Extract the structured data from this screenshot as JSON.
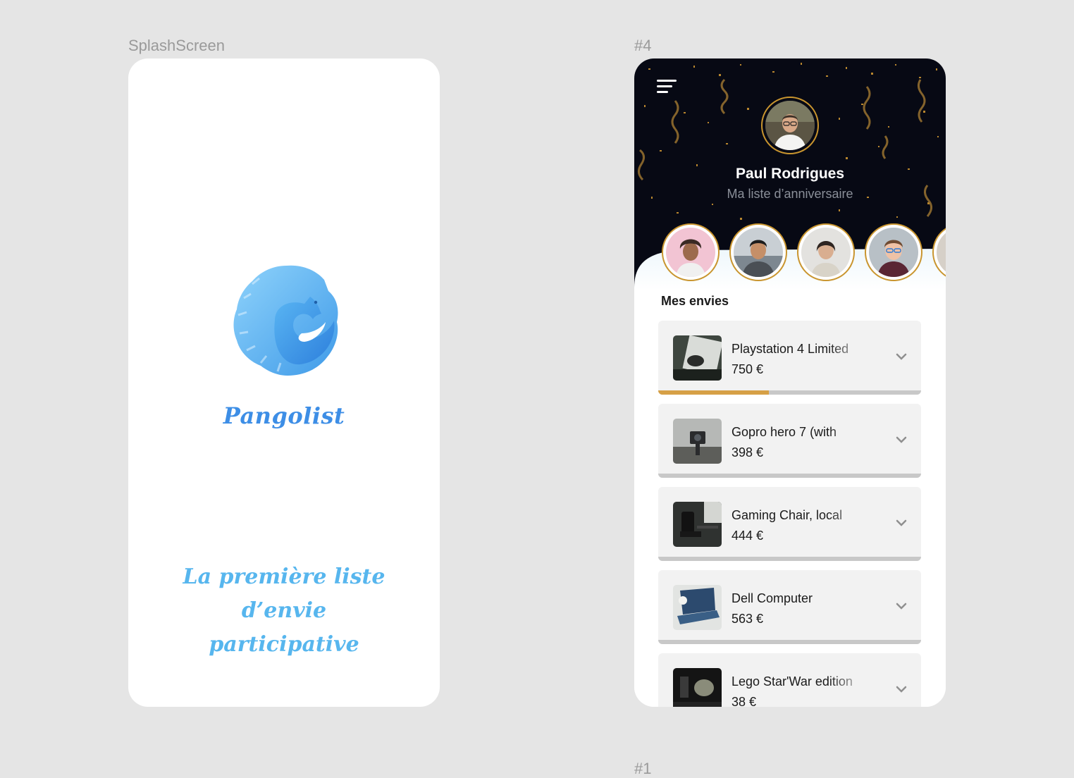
{
  "canvas": {
    "splash_label": "SplashScreen",
    "wishlist_label": "#4",
    "bottom_label": "#1"
  },
  "splash": {
    "brand_name": "Pangolist",
    "tagline_line1": "La première liste d’envie",
    "tagline_line2": "participative",
    "colors": {
      "brand": "#3d8ee6",
      "tagline": "#57b6ee"
    }
  },
  "wishlist": {
    "menu_icon": "hamburger-menu-icon",
    "owner_name": "Paul Rodrigues",
    "list_name": "Ma liste d’anniversaire",
    "friends": [
      {
        "avatar": "friend-avatar-1"
      },
      {
        "avatar": "friend-avatar-2"
      },
      {
        "avatar": "friend-avatar-3"
      },
      {
        "avatar": "friend-avatar-4"
      },
      {
        "avatar": "friend-avatar-5"
      }
    ],
    "section_title": "Mes envies",
    "items": [
      {
        "title": "Playstation 4 Limited",
        "price": "750 €",
        "progress": 0.42
      },
      {
        "title": "Gopro hero 7 (with",
        "price": "398 €",
        "progress": 0
      },
      {
        "title": "Gaming Chair, local",
        "price": "444 €",
        "progress": 0
      },
      {
        "title": "Dell Computer",
        "price": "563 €",
        "progress": 0
      },
      {
        "title": "Lego Star'War edition",
        "price": "38 €",
        "progress": 0
      }
    ],
    "colors": {
      "header_bg": "#070914",
      "gold": "#c9952f",
      "progress": "#d6a046"
    }
  }
}
